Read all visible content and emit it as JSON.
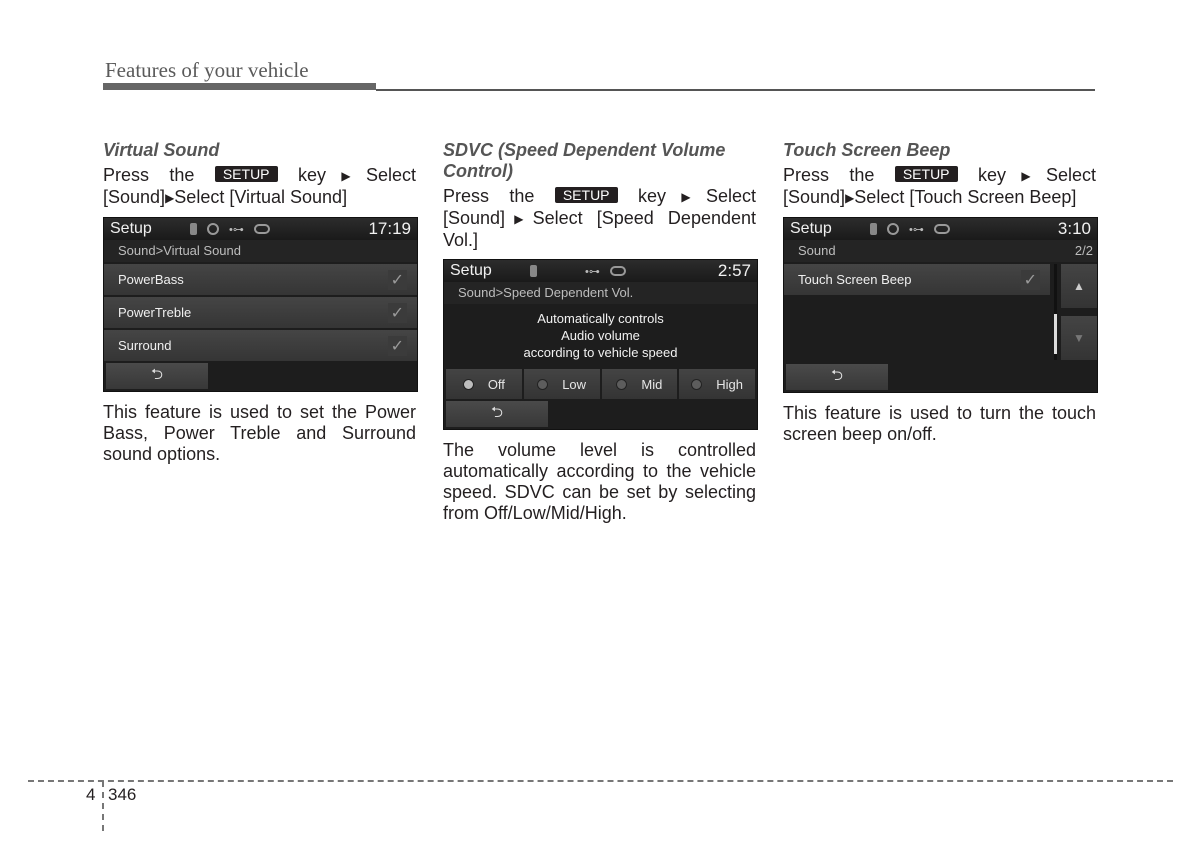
{
  "header": {
    "title": "Features of your vehicle"
  },
  "common": {
    "setup_key": "SETUP",
    "arrow": "▶",
    "back_icon": "⮌",
    "check_icon": "✓"
  },
  "sections": [
    {
      "title": "Virtual Sound",
      "instruction": {
        "press": "Press the",
        "key_select": "key",
        "select1": "Select",
        "sound": "[Sound]",
        "select2": "Select [Virtual Sound]"
      },
      "screen": {
        "title": "Setup",
        "time": "17:19",
        "breadcrumb": "Sound>Virtual Sound",
        "items": [
          {
            "label": "PowerBass",
            "checked": true
          },
          {
            "label": "PowerTreble",
            "checked": true
          },
          {
            "label": "Surround",
            "checked": true
          }
        ]
      },
      "description": "This feature is used to set the Power Bass, Power Treble and Surround sound options."
    },
    {
      "title": "SDVC (Speed Dependent Volume Control)",
      "instruction": {
        "press": "Press the",
        "key_select": "key",
        "select1": "Select",
        "sound": "[Sound]",
        "select2": "Select [Speed Dependent Vol.]"
      },
      "screen": {
        "title": "Setup",
        "time": "2:57",
        "breadcrumb": "Sound>Speed Dependent Vol.",
        "message": [
          "Automatically controls",
          "Audio volume",
          "according to vehicle speed"
        ],
        "options": [
          {
            "label": "Off",
            "selected": true
          },
          {
            "label": "Low",
            "selected": false
          },
          {
            "label": "Mid",
            "selected": false
          },
          {
            "label": "High",
            "selected": false
          }
        ]
      },
      "description": "The volume level is controlled automatically according to the vehicle speed. SDVC can be set by selecting from Off/Low/Mid/High."
    },
    {
      "title": "Touch Screen Beep",
      "instruction": {
        "press": "Press the",
        "key_select": "key",
        "select1": "Select",
        "sound": "[Sound]",
        "select2": "Select [Touch Screen Beep]"
      },
      "screen": {
        "title": "Setup",
        "time": "3:10",
        "breadcrumb": "Sound",
        "page": "2/2",
        "items": [
          {
            "label": "Touch Screen Beep",
            "checked": true
          }
        ],
        "up_icon": "▲",
        "down_icon": "▼"
      },
      "description": "This feature is used to turn the touch screen beep on/off."
    }
  ],
  "footer": {
    "chapter": "4",
    "page": "346"
  }
}
